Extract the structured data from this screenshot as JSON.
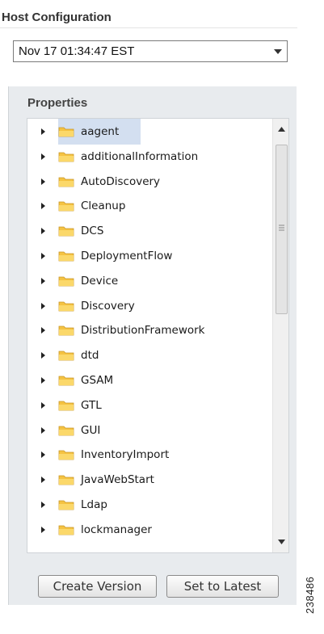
{
  "host": {
    "title": "Host Configuration"
  },
  "version_select": {
    "value": "Nov 17 01:34:47 EST"
  },
  "properties": {
    "title": "Properties",
    "items": [
      {
        "label": "aagent",
        "selected": true
      },
      {
        "label": "additionalInformation"
      },
      {
        "label": "AutoDiscovery"
      },
      {
        "label": "Cleanup"
      },
      {
        "label": "DCS"
      },
      {
        "label": "DeploymentFlow"
      },
      {
        "label": "Device"
      },
      {
        "label": "Discovery"
      },
      {
        "label": "DistributionFramework"
      },
      {
        "label": "dtd"
      },
      {
        "label": "GSAM"
      },
      {
        "label": "GTL"
      },
      {
        "label": "GUI"
      },
      {
        "label": "InventoryImport"
      },
      {
        "label": "JavaWebStart"
      },
      {
        "label": "Ldap"
      },
      {
        "label": "lockmanager"
      }
    ]
  },
  "buttons": {
    "create_version": "Create Version",
    "set_latest": "Set to Latest"
  },
  "figure_id": "238486",
  "colors": {
    "selection": "#d3dff0",
    "folder": "#f5c342",
    "panel": "#e8ebee"
  }
}
